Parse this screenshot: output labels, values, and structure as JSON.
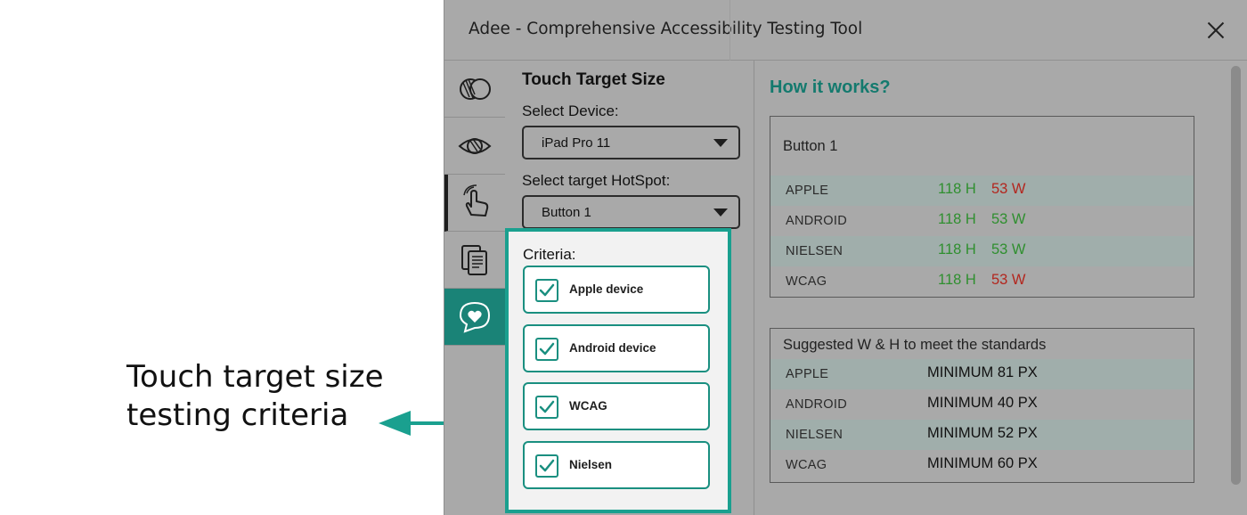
{
  "annotation": {
    "line1": "Touch target size",
    "line2": "testing criteria",
    "color": "#1aa08f"
  },
  "window": {
    "title": "Adee - Comprehensive Accessibility Testing Tool",
    "close_icon": "close-icon"
  },
  "rail": {
    "items": [
      {
        "icon": "color-blindness-icon",
        "state": "inactive"
      },
      {
        "icon": "eye-icon",
        "state": "inactive"
      },
      {
        "icon": "touch-hand-icon",
        "state": "active"
      },
      {
        "icon": "document-icon",
        "state": "inactive"
      },
      {
        "icon": "heart-chat-icon",
        "state": "accent"
      }
    ]
  },
  "panel": {
    "section_title": "Touch Target Size",
    "device_label": "Select Device:",
    "device_value": "iPad Pro 11",
    "hotspot_label": "Select target HotSpot:",
    "hotspot_value": "Button 1",
    "criteria_title": "Criteria:",
    "criteria": [
      {
        "label": "Apple device",
        "checked": true
      },
      {
        "label": "Android device",
        "checked": true
      },
      {
        "label": "WCAG",
        "checked": true
      },
      {
        "label": "Nielsen",
        "checked": true
      }
    ]
  },
  "results": {
    "heading": "How it works?",
    "button_card": {
      "title": "Button 1",
      "rows": [
        {
          "name": "APPLE",
          "h": "118 H",
          "w": "53 W",
          "w_color": "#b3261e"
        },
        {
          "name": "ANDROID",
          "h": "118 H",
          "w": "53 W",
          "w_color": "#2f8f2f"
        },
        {
          "name": "NIELSEN",
          "h": "118 H",
          "w": "53 W",
          "w_color": "#2f8f2f"
        },
        {
          "name": "WCAG",
          "h": "118 H",
          "w": "53 W",
          "w_color": "#b3261e"
        }
      ]
    },
    "suggested_card": {
      "title": "Suggested W & H to meet the standards",
      "rows": [
        {
          "name": "APPLE",
          "min": "MINIMUM 81 PX"
        },
        {
          "name": "ANDROID",
          "min": "MINIMUM 40 PX"
        },
        {
          "name": "NIELSEN",
          "min": "MINIMUM 52 PX"
        },
        {
          "name": "WCAG",
          "min": "MINIMUM 60 PX"
        }
      ]
    }
  },
  "colors": {
    "accent": "#1aa08f",
    "heading": "#147a6e",
    "pass": "#2f8f2f",
    "fail": "#b3261e",
    "overlay_gray": "#a9a9a9"
  }
}
